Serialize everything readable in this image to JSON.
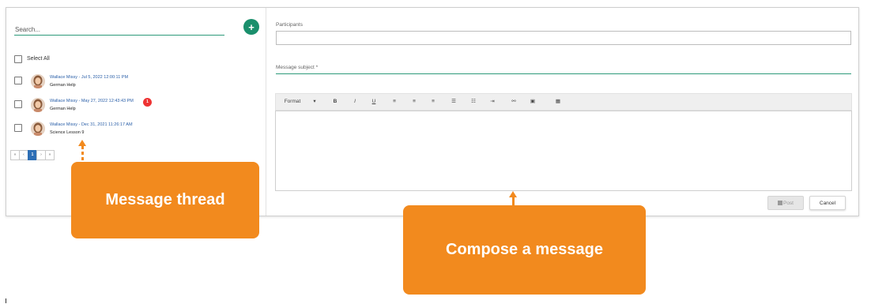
{
  "left_panel": {
    "search_placeholder": "Search...",
    "add_label": "+",
    "select_all_label": "Select All",
    "threads": [
      {
        "meta": "Wallace Missy - Jul 5, 2022 12:00:11 PM",
        "subject": "German Help",
        "unread": ""
      },
      {
        "meta": "Wallace Missy - May 27, 2022 12:43:43 PM",
        "subject": "German Help",
        "unread": "1"
      },
      {
        "meta": "Wallace Missy - Dec 31, 2021 11:26:17 AM",
        "subject": "Science Lesson 9",
        "unread": ""
      }
    ],
    "pager": [
      "«",
      "‹",
      "1",
      "›",
      "»"
    ]
  },
  "compose": {
    "participants_label": "Participants",
    "subject_label": "Message subject *",
    "toolbar": {
      "format_label": "Format",
      "format_caret": "▾",
      "bold": "B",
      "italic": "I",
      "underline": "U",
      "align_left": "≡",
      "align_center": "≡",
      "align_right": "≡",
      "bullet_list": "☰",
      "numbered_list": "☷",
      "indent": "⇥",
      "link": "⚯",
      "image": "▣",
      "table": "▦"
    },
    "post_label": "Post",
    "cancel_label": "Cancel"
  },
  "callouts": {
    "thread_label": "Message thread",
    "compose_label": "Compose a message"
  },
  "colors": {
    "accent_green": "#1a8f6c",
    "callout_orange": "#f28a1e",
    "link_blue": "#2a5fa8",
    "badge_red": "#e33333"
  }
}
